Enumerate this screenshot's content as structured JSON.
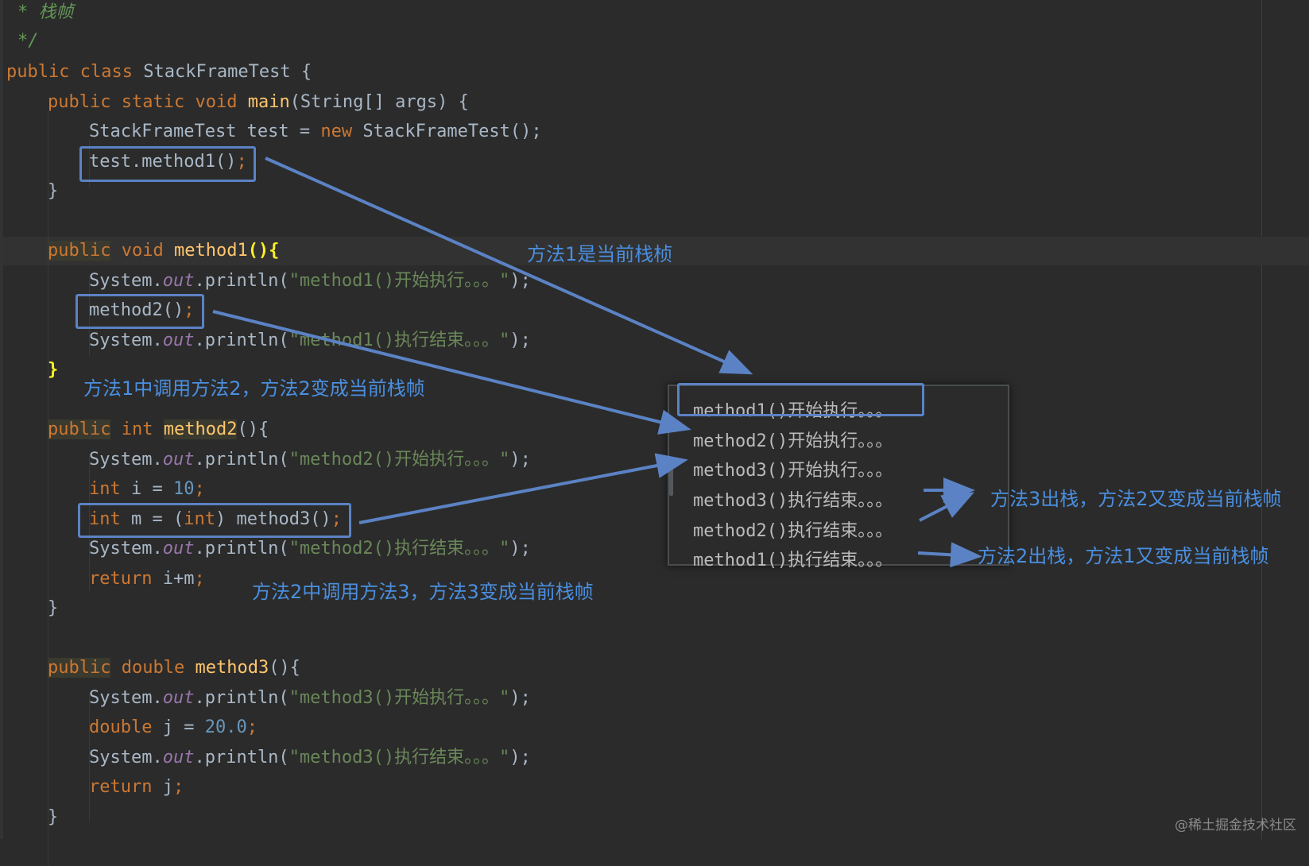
{
  "code": {
    "comment_line1_marker": "*",
    "comment_line1_text": "栈帧",
    "comment_end": "*/",
    "l_class": {
      "kw1": "public",
      "kw2": "class",
      "name": "StackFrameTest",
      "brace": "{"
    },
    "l_main": {
      "kw1": "public",
      "kw2": "static",
      "kw3": "void",
      "fn": "main",
      "params": "(String[] args) {"
    },
    "l_new": {
      "pre": "StackFrameTest test = ",
      "kw": "new",
      "post": " StackFrameTest();"
    },
    "l_call1": {
      "text": "test.method1()",
      "semi": ";"
    },
    "close_brace": "}",
    "l_m1": {
      "kw1": "public",
      "kw2": "void",
      "fn": "method1",
      "paren": "(){"
    },
    "print_pre": "System.",
    "print_out": "out",
    "print_mid": ".println(",
    "print_post": ");",
    "str_m1_start": "\"method1()开始执行。。。\"",
    "l_call2": {
      "text": "method2()",
      "semi": ";"
    },
    "str_m1_end": "\"method1()执行结束。。。\"",
    "m1_close": "}",
    "l_m2": {
      "kw1": "public",
      "kw2": "int",
      "fn": "method2",
      "paren": "(){"
    },
    "str_m2_start": "\"method2()开始执行。。。\"",
    "l_int_i": {
      "kw": "int",
      "mid": " i = ",
      "num": "10",
      "semi": ";"
    },
    "l_int_m": {
      "kw": "int",
      "mid": " m = (",
      "kw2": "int",
      "post": ") method3()",
      "semi": ";"
    },
    "str_m2_end": "\"method2()执行结束。。。\"",
    "l_ret1": {
      "kw": "return",
      "post": " i+m",
      "semi": ";"
    },
    "l_m3": {
      "kw1": "public",
      "kw2": "double",
      "fn": "method3",
      "paren": "(){"
    },
    "str_m3_start": "\"method3()开始执行。。。\"",
    "l_double_j": {
      "kw": "double",
      "mid": " j = ",
      "num": "20.0",
      "semi": ";"
    },
    "str_m3_end": "\"method3()执行结束。。。\"",
    "l_ret2": {
      "kw": "return",
      "post": " j",
      "semi": ";"
    }
  },
  "console": {
    "lines": [
      "method1()开始执行。。。",
      "method2()开始执行。。。",
      "method3()开始执行。。。",
      "method3()执行结束。。。",
      "method2()执行结束。。。",
      "method1()执行结束。。。"
    ]
  },
  "annotations": {
    "a1": "方法1是当前栈桢",
    "a2": "方法1中调用方法2，方法2变成当前栈帧",
    "a3": "方法2中调用方法3，方法3变成当前栈帧",
    "a4": "方法3出栈，方法2又变成当前栈帧",
    "a5": "方法2出栈，方法1又变成当前栈帧"
  },
  "colors": {
    "background": "#2b2b2b",
    "keyword": "#cc7832",
    "function": "#ffc66d",
    "string": "#6a8759",
    "number": "#6897bb",
    "field": "#9876aa",
    "annotation": "#4a8fe0",
    "highlight_box": "#5b82c4"
  },
  "watermark": "@稀土掘金技术社区"
}
